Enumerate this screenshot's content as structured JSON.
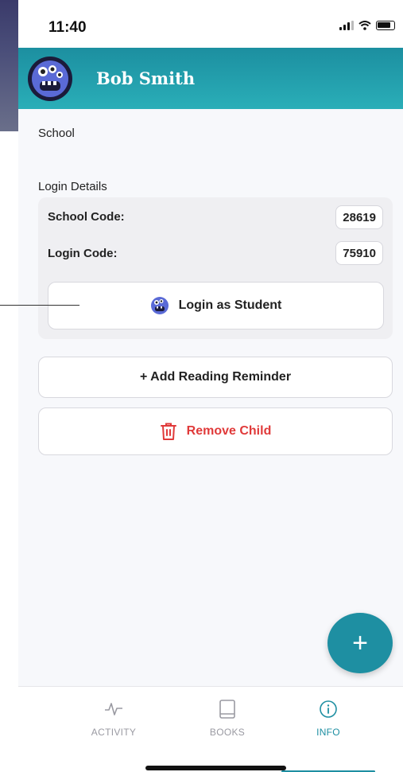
{
  "status": {
    "time": "11:40"
  },
  "header": {
    "name": "Bob Smith"
  },
  "sections": {
    "school_label": "School",
    "login_details_label": "Login Details"
  },
  "login": {
    "school_code_label": "School Code:",
    "school_code_value": "28619",
    "login_code_label": "Login Code:",
    "login_code_value": "75910",
    "login_button_label": "Login as Student"
  },
  "actions": {
    "add_reminder_label": "+ Add Reading Reminder",
    "remove_child_label": "Remove Child"
  },
  "fab": {
    "label": "+"
  },
  "tabs": [
    {
      "label": "ACTIVITY",
      "icon": "activity-icon"
    },
    {
      "label": "BOOKS",
      "icon": "book-icon"
    },
    {
      "label": "INFO",
      "icon": "info-icon"
    }
  ],
  "colors": {
    "accent": "#1e8fa2",
    "danger": "#e03a3a",
    "header_top": "#1c8fa0",
    "header_bottom": "#2aaeb8"
  }
}
